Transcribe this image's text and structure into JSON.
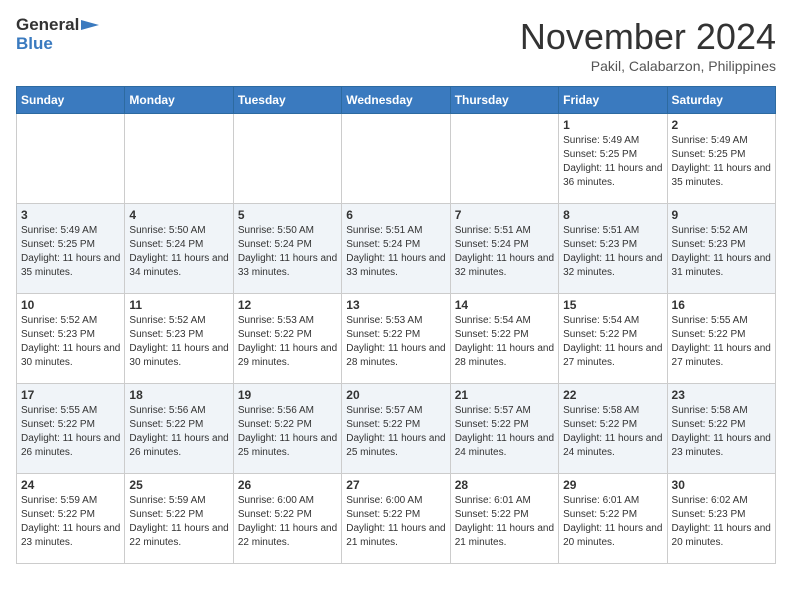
{
  "logo": {
    "line1": "General",
    "line2": "Blue"
  },
  "title": "November 2024",
  "location": "Pakil, Calabarzon, Philippines",
  "days_header": [
    "Sunday",
    "Monday",
    "Tuesday",
    "Wednesday",
    "Thursday",
    "Friday",
    "Saturday"
  ],
  "weeks": [
    [
      {
        "day": "",
        "info": ""
      },
      {
        "day": "",
        "info": ""
      },
      {
        "day": "",
        "info": ""
      },
      {
        "day": "",
        "info": ""
      },
      {
        "day": "",
        "info": ""
      },
      {
        "day": "1",
        "info": "Sunrise: 5:49 AM\nSunset: 5:25 PM\nDaylight: 11 hours and 36 minutes."
      },
      {
        "day": "2",
        "info": "Sunrise: 5:49 AM\nSunset: 5:25 PM\nDaylight: 11 hours and 35 minutes."
      }
    ],
    [
      {
        "day": "3",
        "info": "Sunrise: 5:49 AM\nSunset: 5:25 PM\nDaylight: 11 hours and 35 minutes."
      },
      {
        "day": "4",
        "info": "Sunrise: 5:50 AM\nSunset: 5:24 PM\nDaylight: 11 hours and 34 minutes."
      },
      {
        "day": "5",
        "info": "Sunrise: 5:50 AM\nSunset: 5:24 PM\nDaylight: 11 hours and 33 minutes."
      },
      {
        "day": "6",
        "info": "Sunrise: 5:51 AM\nSunset: 5:24 PM\nDaylight: 11 hours and 33 minutes."
      },
      {
        "day": "7",
        "info": "Sunrise: 5:51 AM\nSunset: 5:24 PM\nDaylight: 11 hours and 32 minutes."
      },
      {
        "day": "8",
        "info": "Sunrise: 5:51 AM\nSunset: 5:23 PM\nDaylight: 11 hours and 32 minutes."
      },
      {
        "day": "9",
        "info": "Sunrise: 5:52 AM\nSunset: 5:23 PM\nDaylight: 11 hours and 31 minutes."
      }
    ],
    [
      {
        "day": "10",
        "info": "Sunrise: 5:52 AM\nSunset: 5:23 PM\nDaylight: 11 hours and 30 minutes."
      },
      {
        "day": "11",
        "info": "Sunrise: 5:52 AM\nSunset: 5:23 PM\nDaylight: 11 hours and 30 minutes."
      },
      {
        "day": "12",
        "info": "Sunrise: 5:53 AM\nSunset: 5:22 PM\nDaylight: 11 hours and 29 minutes."
      },
      {
        "day": "13",
        "info": "Sunrise: 5:53 AM\nSunset: 5:22 PM\nDaylight: 11 hours and 28 minutes."
      },
      {
        "day": "14",
        "info": "Sunrise: 5:54 AM\nSunset: 5:22 PM\nDaylight: 11 hours and 28 minutes."
      },
      {
        "day": "15",
        "info": "Sunrise: 5:54 AM\nSunset: 5:22 PM\nDaylight: 11 hours and 27 minutes."
      },
      {
        "day": "16",
        "info": "Sunrise: 5:55 AM\nSunset: 5:22 PM\nDaylight: 11 hours and 27 minutes."
      }
    ],
    [
      {
        "day": "17",
        "info": "Sunrise: 5:55 AM\nSunset: 5:22 PM\nDaylight: 11 hours and 26 minutes."
      },
      {
        "day": "18",
        "info": "Sunrise: 5:56 AM\nSunset: 5:22 PM\nDaylight: 11 hours and 26 minutes."
      },
      {
        "day": "19",
        "info": "Sunrise: 5:56 AM\nSunset: 5:22 PM\nDaylight: 11 hours and 25 minutes."
      },
      {
        "day": "20",
        "info": "Sunrise: 5:57 AM\nSunset: 5:22 PM\nDaylight: 11 hours and 25 minutes."
      },
      {
        "day": "21",
        "info": "Sunrise: 5:57 AM\nSunset: 5:22 PM\nDaylight: 11 hours and 24 minutes."
      },
      {
        "day": "22",
        "info": "Sunrise: 5:58 AM\nSunset: 5:22 PM\nDaylight: 11 hours and 24 minutes."
      },
      {
        "day": "23",
        "info": "Sunrise: 5:58 AM\nSunset: 5:22 PM\nDaylight: 11 hours and 23 minutes."
      }
    ],
    [
      {
        "day": "24",
        "info": "Sunrise: 5:59 AM\nSunset: 5:22 PM\nDaylight: 11 hours and 23 minutes."
      },
      {
        "day": "25",
        "info": "Sunrise: 5:59 AM\nSunset: 5:22 PM\nDaylight: 11 hours and 22 minutes."
      },
      {
        "day": "26",
        "info": "Sunrise: 6:00 AM\nSunset: 5:22 PM\nDaylight: 11 hours and 22 minutes."
      },
      {
        "day": "27",
        "info": "Sunrise: 6:00 AM\nSunset: 5:22 PM\nDaylight: 11 hours and 21 minutes."
      },
      {
        "day": "28",
        "info": "Sunrise: 6:01 AM\nSunset: 5:22 PM\nDaylight: 11 hours and 21 minutes."
      },
      {
        "day": "29",
        "info": "Sunrise: 6:01 AM\nSunset: 5:22 PM\nDaylight: 11 hours and 20 minutes."
      },
      {
        "day": "30",
        "info": "Sunrise: 6:02 AM\nSunset: 5:23 PM\nDaylight: 11 hours and 20 minutes."
      }
    ]
  ]
}
